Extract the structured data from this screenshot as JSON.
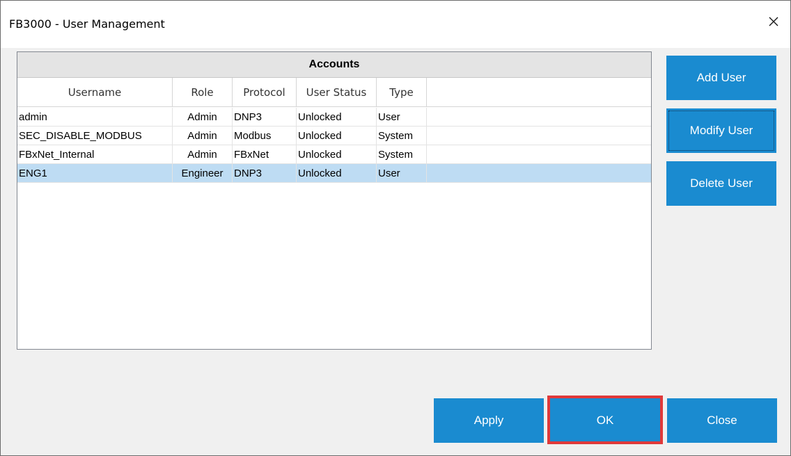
{
  "window": {
    "title": "FB3000 - User Management",
    "close_glyph": "✕"
  },
  "accounts": {
    "title": "Accounts",
    "columns": [
      "Username",
      "Role",
      "Protocol",
      "User Status",
      "Type"
    ],
    "rows": [
      [
        "admin",
        "Admin",
        "DNP3",
        "Unlocked",
        "User"
      ],
      [
        "SEC_DISABLE_MODBUS",
        "Admin",
        "Modbus",
        "Unlocked",
        "System"
      ],
      [
        "FBxNet_Internal",
        "Admin",
        "FBxNet",
        "Unlocked",
        "System"
      ],
      [
        "ENG1",
        "Engineer",
        "DNP3",
        "Unlocked",
        "User"
      ]
    ],
    "selected_row": 3
  },
  "side_buttons": {
    "add": "Add User",
    "modify": "Modify User",
    "delete": "Delete User"
  },
  "footer_buttons": {
    "apply": "Apply",
    "ok": "OK",
    "close": "Close"
  },
  "colors": {
    "button_bg": "#1a8bd0",
    "selected_row": "#bedcf3",
    "highlight": "#e0393a"
  },
  "icons": {
    "close": "close-icon"
  }
}
